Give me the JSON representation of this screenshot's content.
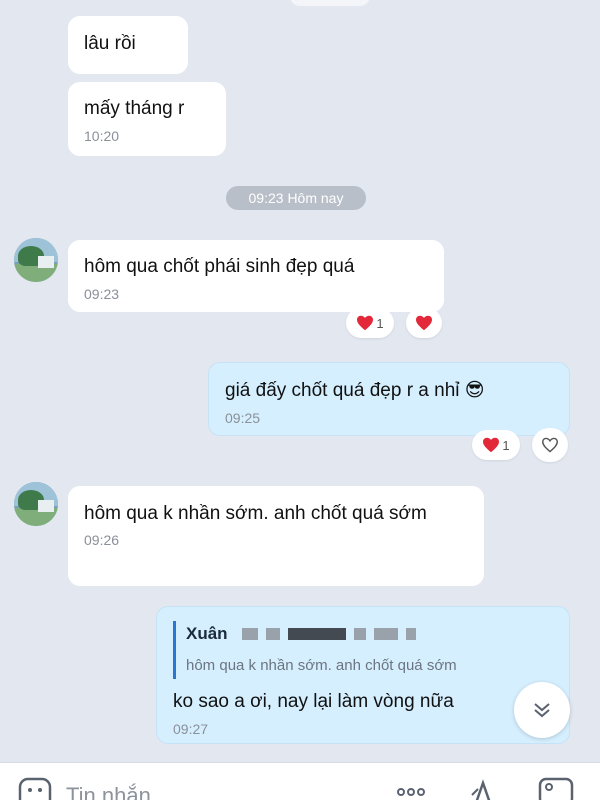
{
  "messages": [
    {
      "text": "lâu rồi"
    },
    {
      "text": "mấy tháng r",
      "time": "10:20"
    },
    {
      "text": "hôm qua chốt phái sinh đẹp quá",
      "time": "09:23",
      "reaction_count": "1"
    },
    {
      "text": "giá đấy chốt quá đẹp r a nhỉ 😎",
      "time": "09:25",
      "reaction_count": "1"
    },
    {
      "text": "hôm qua k nhần sớm. anh chốt quá sớm",
      "time": "09:26"
    },
    {
      "quote_name": "Xuân",
      "quote_text": "hôm qua k nhần sớm. anh chốt quá sớm",
      "text": "ko sao a ơi, nay lại làm vòng nữa",
      "time": "09:27"
    }
  ],
  "date_separator": "09:23 Hôm nay",
  "input": {
    "placeholder": "Tin nhắn"
  },
  "colors": {
    "background": "#e2e7f0",
    "incoming_bubble": "#ffffff",
    "outgoing_bubble": "#d5efff",
    "heart": "#e3283a",
    "quote_bar": "#2a76d2"
  },
  "icons": [
    "heart-icon",
    "heart-outline-icon",
    "chevron-down-double-icon",
    "sticker-icon",
    "more-icon",
    "text-format-icon",
    "image-icon"
  ]
}
